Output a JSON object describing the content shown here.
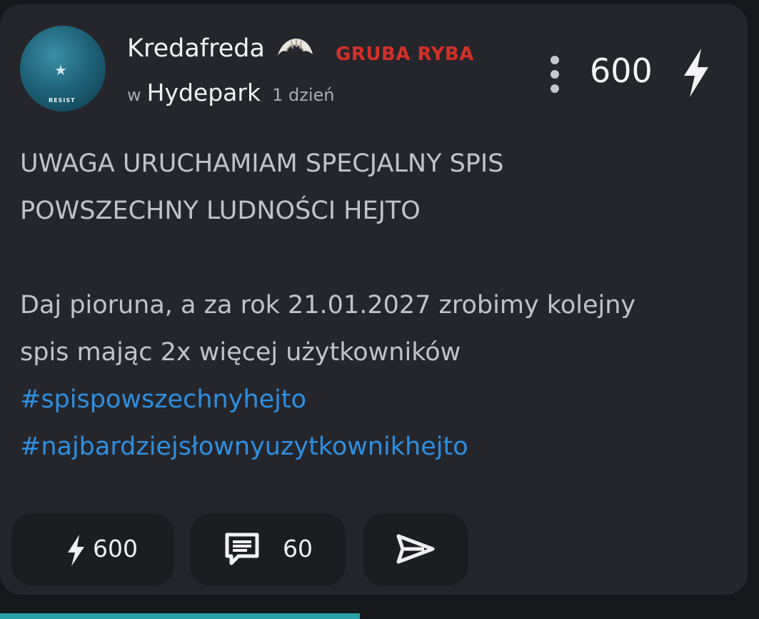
{
  "post": {
    "author": "Kredafreda",
    "rank": "GRUBA RYBA",
    "community_prefix": "w",
    "community": "Hydepark",
    "time": "1 dzień",
    "score": "600",
    "avatar_text": "RESIST",
    "lines": [
      "UWAGA URUCHAMIAM SPECJALNY SPIS",
      "POWSZECHNY LUDNOŚCI HEJTO",
      "Daj pioruna, a za rok 21.01.2027 zrobimy kolejny",
      "spis mając 2x więcej użytkowników"
    ],
    "hashtags": [
      "#spispowszechnyhejto",
      "#najbardziejsłownyuzytkownikhejto"
    ]
  },
  "actions": {
    "like_count": "600",
    "comment_count": "60"
  },
  "colors": {
    "rank": "#d3302a",
    "hashtag": "#2f8fe0",
    "card": "#25262b",
    "action_bg": "#1c1d21"
  },
  "icons": [
    "croissant-icon",
    "more-vertical-icon",
    "bolt-icon",
    "comment-icon",
    "send-icon"
  ]
}
